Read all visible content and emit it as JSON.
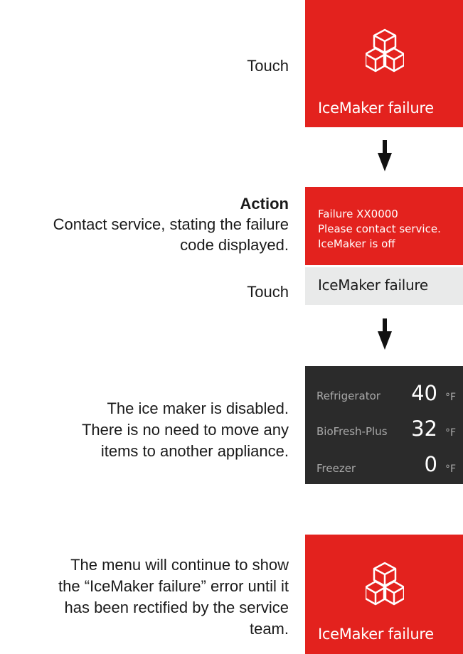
{
  "step1": {
    "instruction": "Touch",
    "panel_label": "IceMaker failure",
    "icon": "ice-cubes-icon"
  },
  "step2": {
    "action_heading": "Action",
    "action_line1": "Contact service, stating the failure",
    "action_line2": "code displayed.",
    "error_line1": "Failure XX0000",
    "error_line2": "Please contact service.",
    "error_line3": "IceMaker is off",
    "instruction": "Touch",
    "button_label": "IceMaker failure"
  },
  "step3": {
    "text_line1": "The ice maker is disabled.",
    "text_line2": "There is no need to move any",
    "text_line3": "items to another appliance.",
    "rows": [
      {
        "label": "Refrigerator",
        "value": "40",
        "unit": "°F"
      },
      {
        "label": "BioFresh-Plus",
        "value": "32",
        "unit": "°F"
      },
      {
        "label": "Freezer",
        "value": "0",
        "unit": "°F"
      }
    ]
  },
  "step4": {
    "text_line1": "The menu will continue to show",
    "text_line2": "the “IceMaker failure” error until it",
    "text_line3": "has been rectified by the service",
    "text_line4": "team.",
    "panel_label": "IceMaker failure",
    "icon": "ice-cubes-icon"
  },
  "colors": {
    "red": "#e3221e",
    "dark": "#2b2b2b",
    "light_grey": "#e9eaea"
  }
}
